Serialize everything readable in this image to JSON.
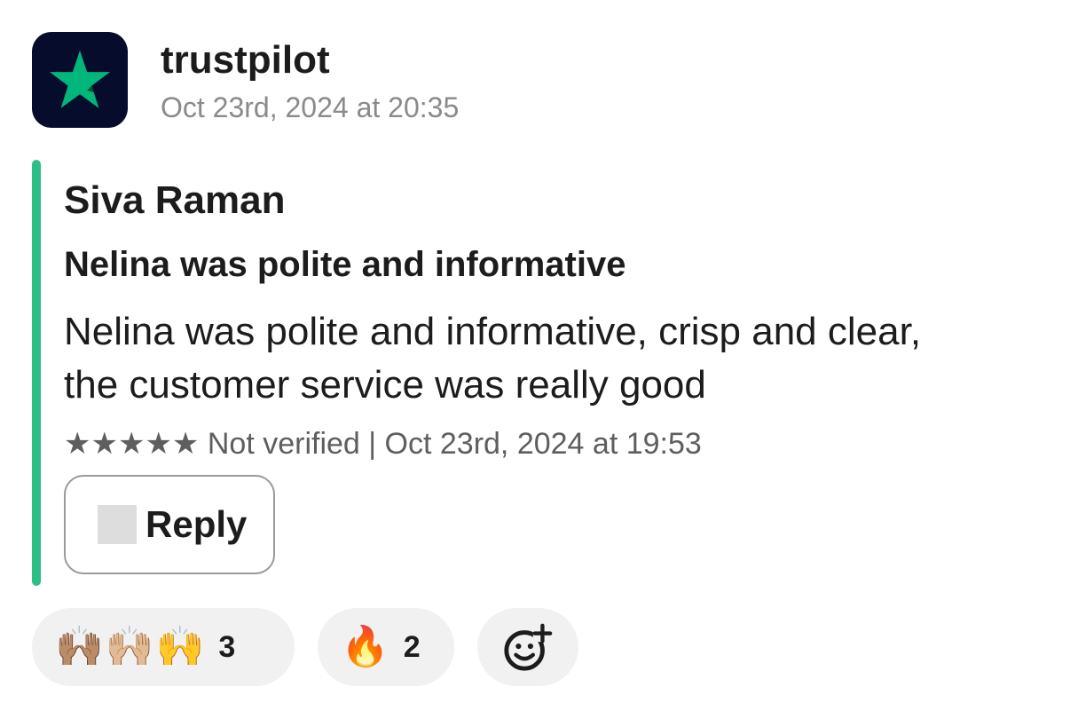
{
  "message": {
    "sender": "trustpilot",
    "timestamp": "Oct 23rd, 2024 at 20:35",
    "avatar_icon": "trustpilot-star-icon",
    "colors": {
      "avatar_bg": "#060c2c",
      "star": "#00b67a",
      "attachment_bar": "#2bbf85"
    }
  },
  "review": {
    "reviewer": "Siva Raman",
    "title": "Nelina was polite and informative",
    "body": "Nelina was polite and informative, crisp and clear, the customer service was really good",
    "stars": "★★★★★",
    "rating": 5,
    "meta": "Not verified | Oct 23rd, 2024 at 19:53"
  },
  "actions": {
    "reply_label": "Reply"
  },
  "reactions": [
    {
      "emoji": "🙌🏽🙌🏼🙌",
      "count": "3"
    },
    {
      "emoji": "🔥",
      "count": "2"
    }
  ],
  "add_reaction_icon": "add-reaction-icon"
}
